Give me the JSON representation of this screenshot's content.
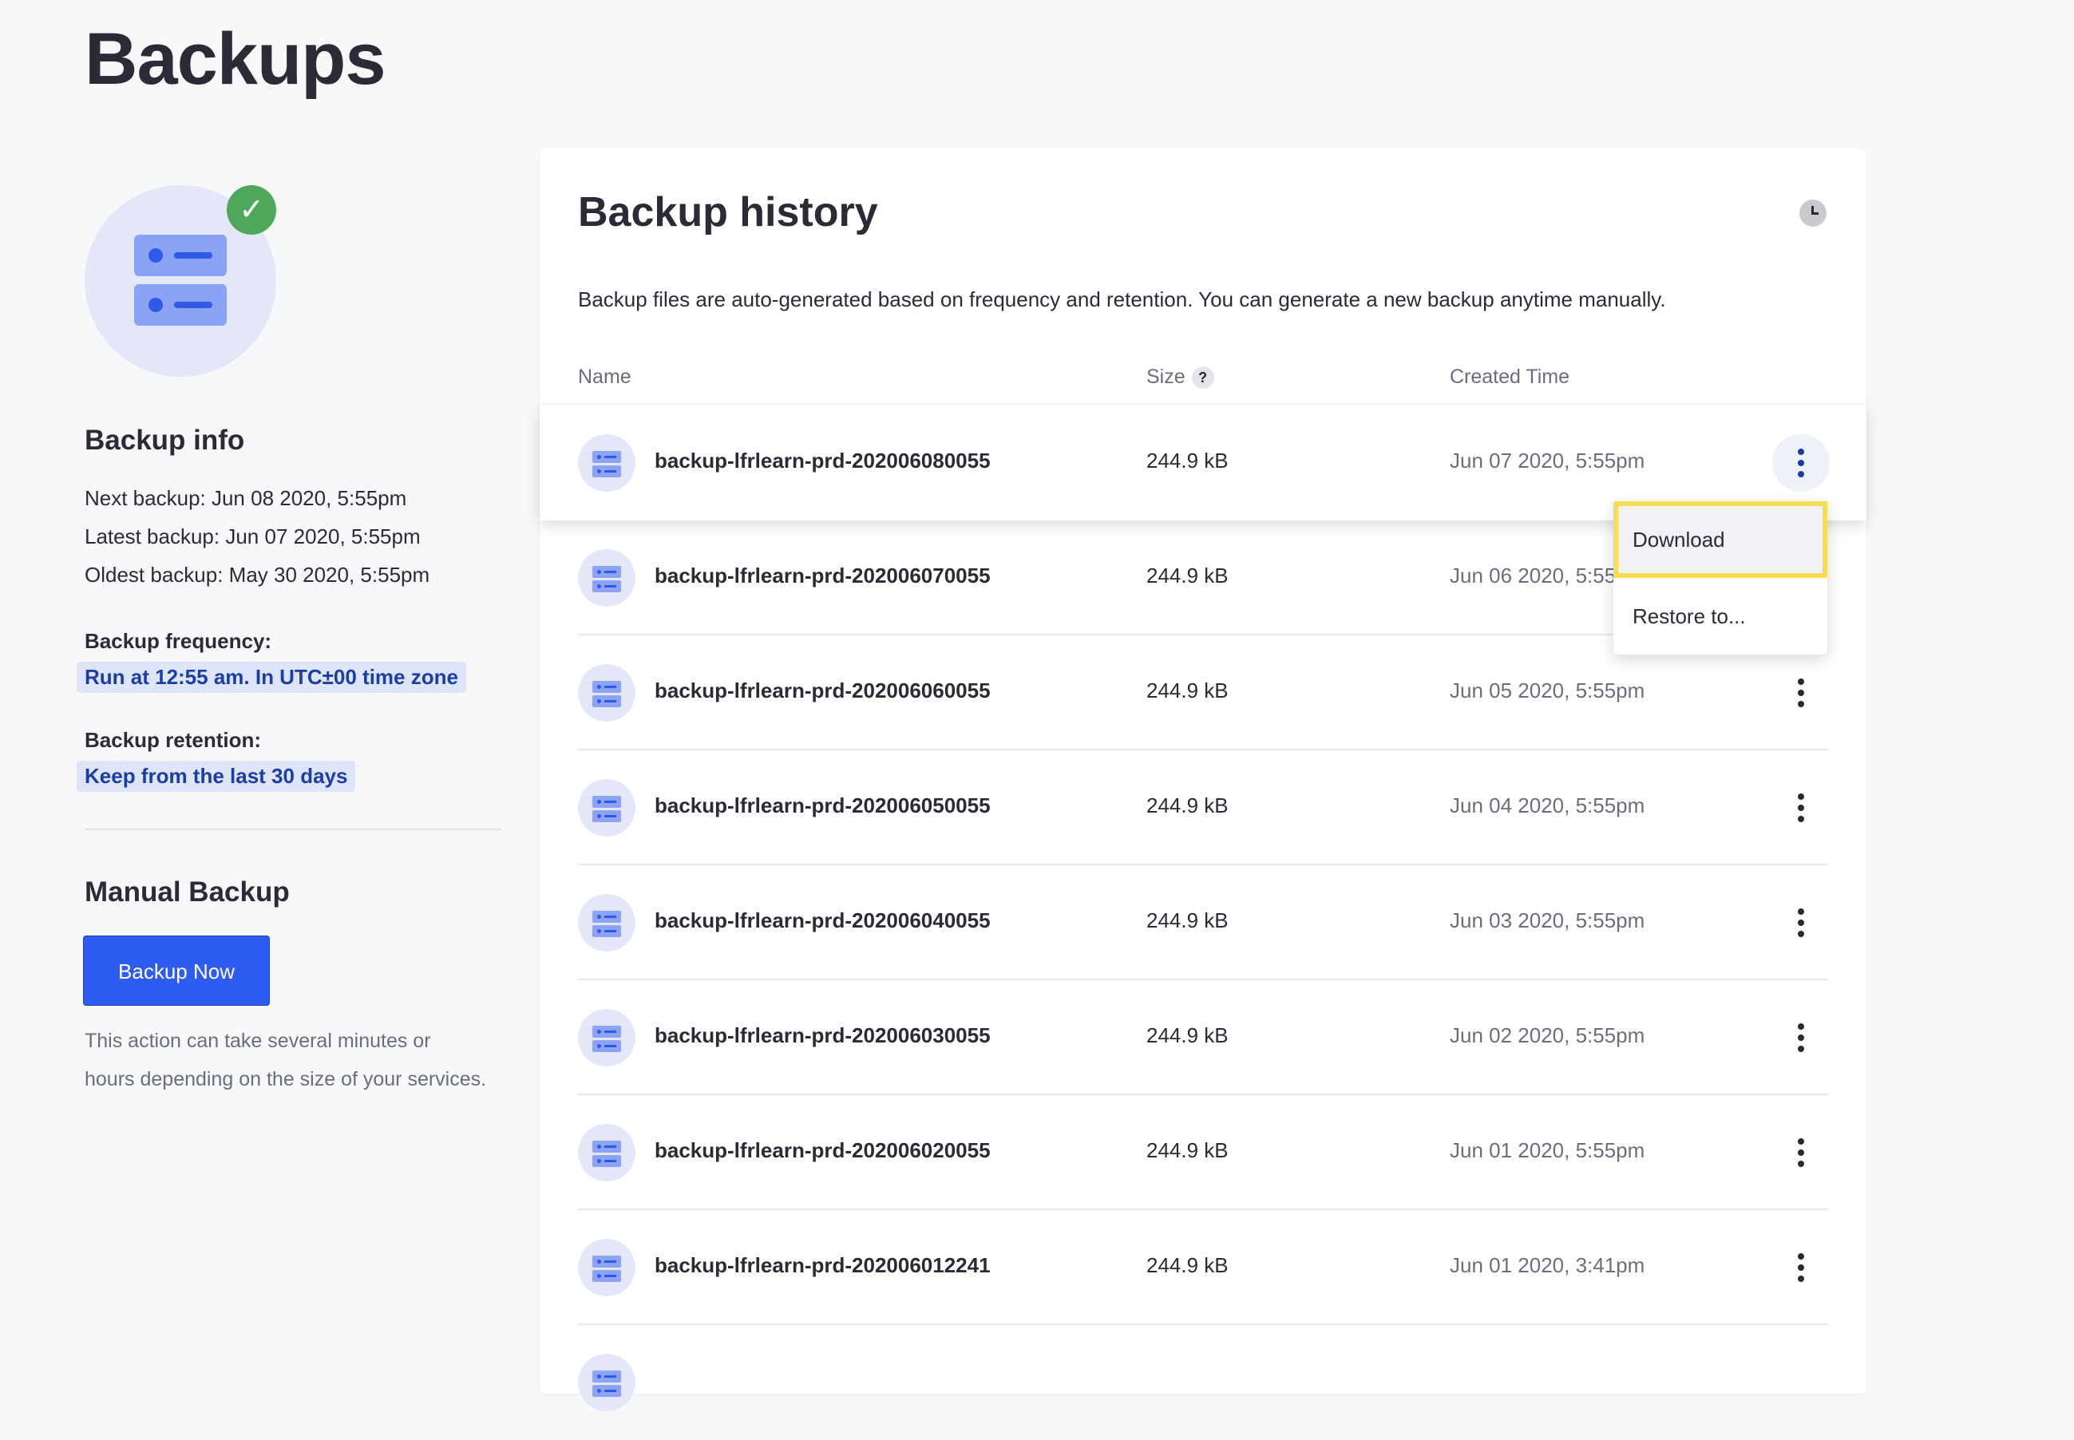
{
  "page": {
    "title": "Backups"
  },
  "backup_info": {
    "title": "Backup info",
    "next_backup": "Next backup: Jun 08 2020, 5:55pm",
    "latest_backup": "Latest backup: Jun 07 2020, 5:55pm",
    "oldest_backup": "Oldest backup: May 30 2020, 5:55pm",
    "frequency_label": "Backup frequency:",
    "frequency_value": "Run at 12:55 am. In UTC±00 time zone",
    "retention_label": "Backup retention:",
    "retention_value": "Keep from the last 30 days",
    "status_check": "✓"
  },
  "manual_backup": {
    "title": "Manual Backup",
    "button_label": "Backup Now",
    "help_line1": "This action can take several minutes or",
    "help_line2": "hours depending on the size of your services."
  },
  "history": {
    "title": "Backup history",
    "description": "Backup files are auto-generated based on frequency and retention. You can generate a new backup anytime manually.",
    "columns": {
      "name": "Name",
      "size": "Size",
      "size_help": "?",
      "created": "Created Time"
    },
    "rows": [
      {
        "name": "backup-lfrlearn-prd-202006080055",
        "size": "244.9 kB",
        "created": "Jun 07 2020, 5:55pm"
      },
      {
        "name": "backup-lfrlearn-prd-202006070055",
        "size": "244.9 kB",
        "created": "Jun 06 2020, 5:55"
      },
      {
        "name": "backup-lfrlearn-prd-202006060055",
        "size": "244.9 kB",
        "created": "Jun 05 2020, 5:55pm"
      },
      {
        "name": "backup-lfrlearn-prd-202006050055",
        "size": "244.9 kB",
        "created": "Jun 04 2020, 5:55pm"
      },
      {
        "name": "backup-lfrlearn-prd-202006040055",
        "size": "244.9 kB",
        "created": "Jun 03 2020, 5:55pm"
      },
      {
        "name": "backup-lfrlearn-prd-202006030055",
        "size": "244.9 kB",
        "created": "Jun 02 2020, 5:55pm"
      },
      {
        "name": "backup-lfrlearn-prd-202006020055",
        "size": "244.9 kB",
        "created": "Jun 01 2020, 5:55pm"
      },
      {
        "name": "backup-lfrlearn-prd-202006012241",
        "size": "244.9 kB",
        "created": "Jun 01 2020, 3:41pm"
      }
    ],
    "menu": {
      "download": "Download",
      "restore": "Restore to..."
    }
  },
  "colors": {
    "primary": "#2e5bf0",
    "success": "#4ea75a",
    "highlight": "#f6dd53"
  },
  "icons": [
    "server-icon",
    "check-icon",
    "clock-icon",
    "help-icon",
    "kebab-icon"
  ]
}
